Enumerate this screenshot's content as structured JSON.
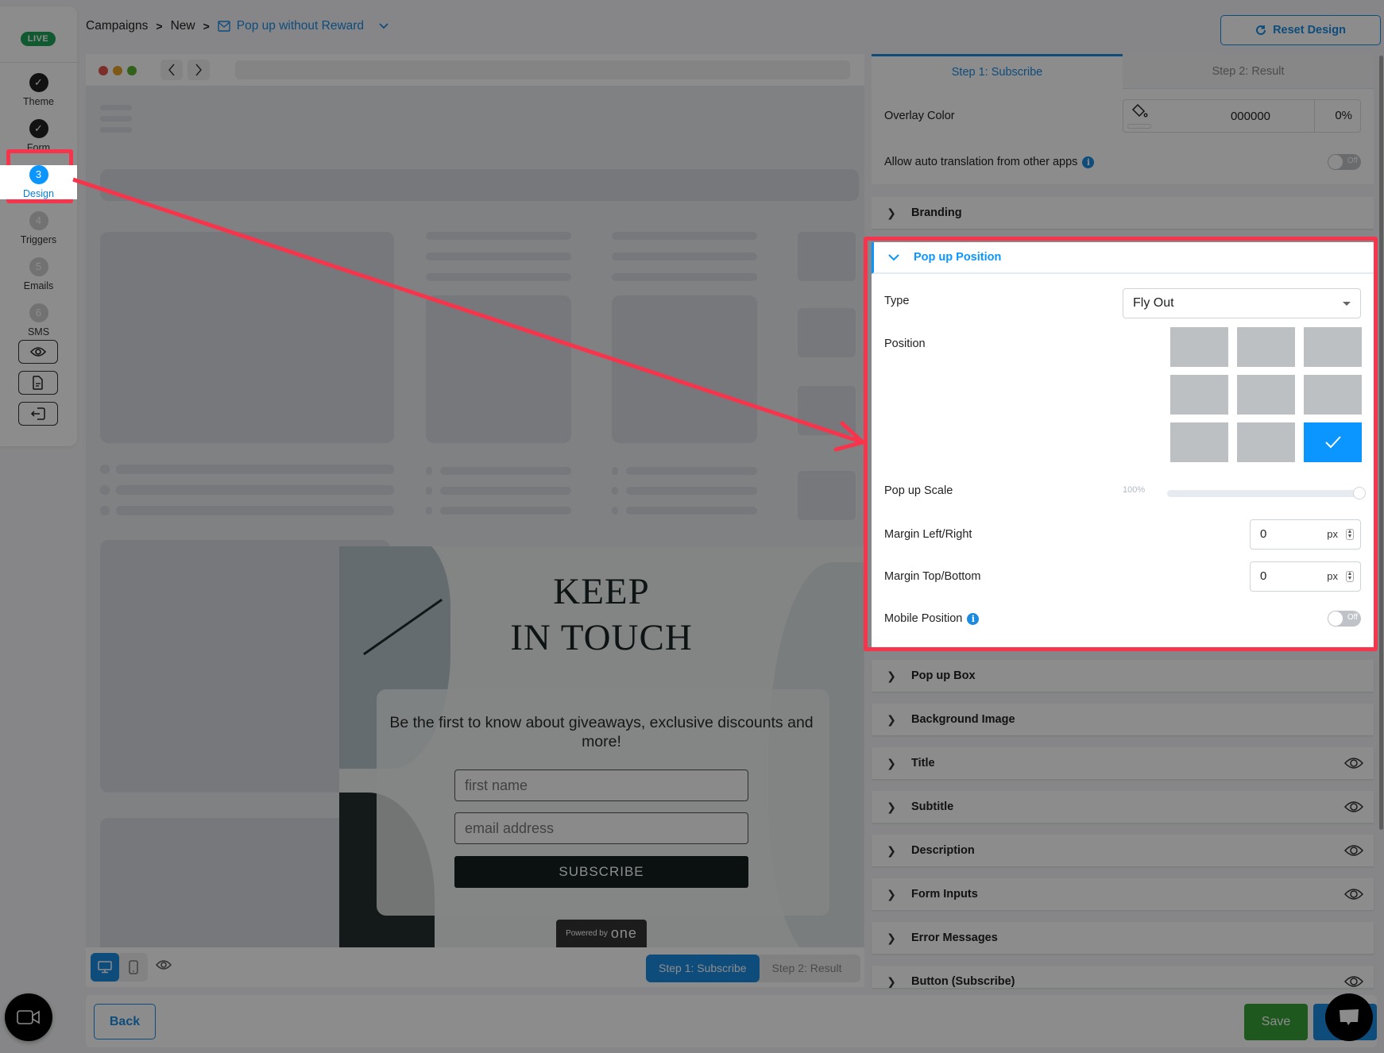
{
  "sidebar": {
    "status_badge": "LIVE",
    "steps": [
      {
        "number": "✓",
        "label": "Theme",
        "state": "done"
      },
      {
        "number": "✓",
        "label": "Form",
        "state": "done"
      },
      {
        "number": "3",
        "label": "Design",
        "state": "active"
      },
      {
        "number": "4",
        "label": "Triggers",
        "state": "pending"
      },
      {
        "number": "5",
        "label": "Emails",
        "state": "pending"
      },
      {
        "number": "6",
        "label": "SMS",
        "state": "pending"
      }
    ],
    "tools": [
      "preview-icon",
      "document-icon",
      "exit-icon"
    ]
  },
  "breadcrumb": {
    "items": [
      "Campaigns",
      "New"
    ],
    "separator": ">",
    "current": "Pop up without Reward"
  },
  "header": {
    "reset_label": "Reset Design"
  },
  "preview": {
    "popup": {
      "title_line1": "KEEP",
      "title_line2": "IN TOUCH",
      "description": "Be the first to know about giveaways, exclusive discounts and more!",
      "first_name_placeholder": "first name",
      "email_placeholder": "email address",
      "submit_label": "SUBSCRIBE",
      "powered_by": "Powered by",
      "brand": "one"
    },
    "footer": {
      "devices": [
        "desktop",
        "mobile"
      ],
      "active_device": "desktop",
      "step_tabs": [
        "Step 1: Subscribe",
        "Step 2: Result"
      ],
      "active_step": "Step 1: Subscribe"
    }
  },
  "panel": {
    "tabs": [
      "Step 1: Subscribe",
      "Step 2: Result"
    ],
    "active_tab": "Step 1: Subscribe",
    "overlay_color": {
      "label": "Overlay Color",
      "hex": "000000",
      "opacity": "0%"
    },
    "auto_translation": {
      "label": "Allow auto translation from other apps",
      "value": "Off"
    },
    "sections_before": [
      {
        "name": "Branding",
        "has_eye": false
      }
    ],
    "expanded": {
      "name": "Pop up Position",
      "type_label": "Type",
      "type_value": "Fly Out",
      "position_label": "Position",
      "position_grid": [
        "top-left",
        "top-center",
        "top-right",
        "middle-left",
        "middle-center",
        "middle-right",
        "bottom-left",
        "bottom-center",
        "bottom-right"
      ],
      "position_selected": "bottom-right",
      "scale_label": "Pop up Scale",
      "scale_value": "100%",
      "scale_percent": 100,
      "margin_lr_label": "Margin Left/Right",
      "margin_lr_value": "0",
      "margin_tb_label": "Margin Top/Bottom",
      "margin_tb_value": "0",
      "unit": "px",
      "mobile_position_label": "Mobile Position",
      "mobile_position_value": "Off"
    },
    "sections_after": [
      {
        "name": "Pop up Box",
        "has_eye": false
      },
      {
        "name": "Background Image",
        "has_eye": false
      },
      {
        "name": "Title",
        "has_eye": true
      },
      {
        "name": "Subtitle",
        "has_eye": true
      },
      {
        "name": "Description",
        "has_eye": true
      },
      {
        "name": "Form Inputs",
        "has_eye": true
      },
      {
        "name": "Error Messages",
        "has_eye": false
      },
      {
        "name": "Button (Subscribe)",
        "has_eye": true
      }
    ]
  },
  "bottom_bar": {
    "back_label": "Back",
    "save_label": "Save"
  },
  "annotation": {
    "highlight_color": "#f7344b"
  }
}
